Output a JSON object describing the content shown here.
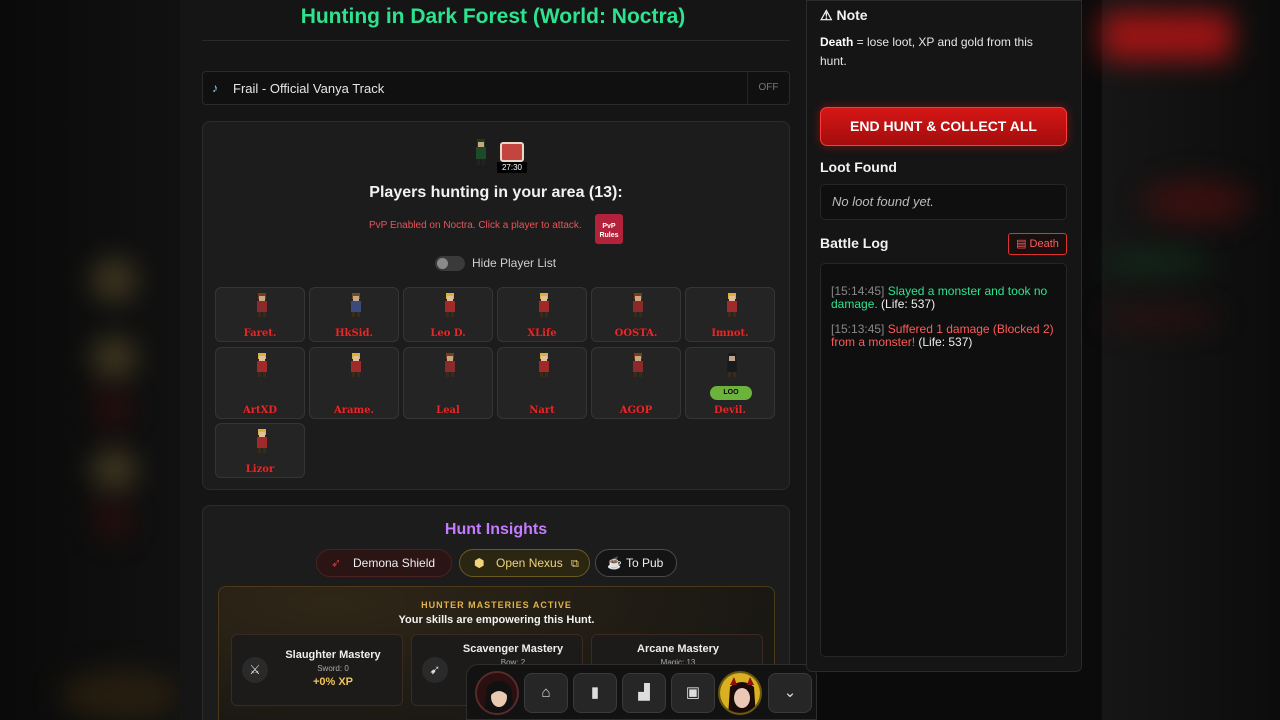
{
  "main": {
    "title": "Hunting in Dark Forest (World: Noctra)",
    "music": {
      "track": "Frail - Official Vanya Track",
      "toggle": "OFF"
    },
    "hunt": {
      "chest_timer": "27:30",
      "players_heading": "Players hunting in your area (13):",
      "pvp_notice": "PvP Enabled on Noctra. Click a player to attack.",
      "pvp_rules": "PvP Rules",
      "hide_list_label": "Hide Player List",
      "players": [
        {
          "name": "Faret.",
          "sprite": "male",
          "badge": ""
        },
        {
          "name": "HkSid.",
          "sprite": "male-blue",
          "badge": ""
        },
        {
          "name": "Leo D.",
          "sprite": "female",
          "badge": ""
        },
        {
          "name": "XLife",
          "sprite": "female",
          "badge": ""
        },
        {
          "name": "OOSTA.",
          "sprite": "male",
          "badge": ""
        },
        {
          "name": "Imnot.",
          "sprite": "female",
          "badge": ""
        },
        {
          "name": "ArtXD",
          "sprite": "female",
          "badge": ""
        },
        {
          "name": "Arame.",
          "sprite": "female",
          "badge": ""
        },
        {
          "name": "Leal",
          "sprite": "male",
          "badge": ""
        },
        {
          "name": "Nart",
          "sprite": "female",
          "badge": ""
        },
        {
          "name": "AGOP",
          "sprite": "male",
          "badge": ""
        },
        {
          "name": "Devil.",
          "sprite": "dark",
          "badge": "LOO"
        },
        {
          "name": "Lizor",
          "sprite": "female",
          "badge": ""
        }
      ]
    },
    "insights": {
      "title": "Hunt Insights",
      "buttons": [
        {
          "label": "Demona Shield",
          "icon": "feather-icon"
        },
        {
          "label": "Open Nexus",
          "icon": "hex-icon"
        },
        {
          "label": "To Pub",
          "icon": "mug-icon"
        }
      ],
      "mastery_heading": "HUNTER MASTERIES ACTIVE",
      "mastery_sub": "Your skills are empowering this Hunt.",
      "masteries": [
        {
          "name": "Slaughter Mastery",
          "level": "Sword: 0",
          "bonus": "+0% XP",
          "icon": "swords-icon"
        },
        {
          "name": "Scavenger Mastery",
          "level": "Bow: 2",
          "bonus": "",
          "icon": "bow-icon"
        },
        {
          "name": "Arcane Mastery",
          "level": "Magic: 13",
          "bonus": "",
          "icon": "magic-icon"
        }
      ]
    }
  },
  "side": {
    "note_title": "Note",
    "note_bold": "Death",
    "note_text": " = lose loot, XP and gold from this hunt.",
    "end_hunt": "END HUNT & COLLECT ALL",
    "loot_title": "Loot Found",
    "loot_empty": "No loot found yet.",
    "log_title": "Battle Log",
    "death_button": "Death",
    "log": [
      {
        "time": "[15:14:45]",
        "text": "Slayed a monster and took no damage.",
        "life": "(Life: 537)",
        "kind": "good"
      },
      {
        "time": "[15:13:45]",
        "text": "Suffered 1 damage (Blocked 2) from a monster!",
        "life": "(Life: 537)",
        "kind": "bad"
      }
    ]
  },
  "nav": {
    "items": [
      "avatar",
      "home-icon",
      "mug-icon",
      "podium-icon",
      "money-icon",
      "avatar-2",
      "chevron-down-icon"
    ]
  },
  "colors": {
    "title": "#2ee38f",
    "accent_red": "#d61616",
    "insights": "#c57bff",
    "mastery": "#e2b34a"
  }
}
